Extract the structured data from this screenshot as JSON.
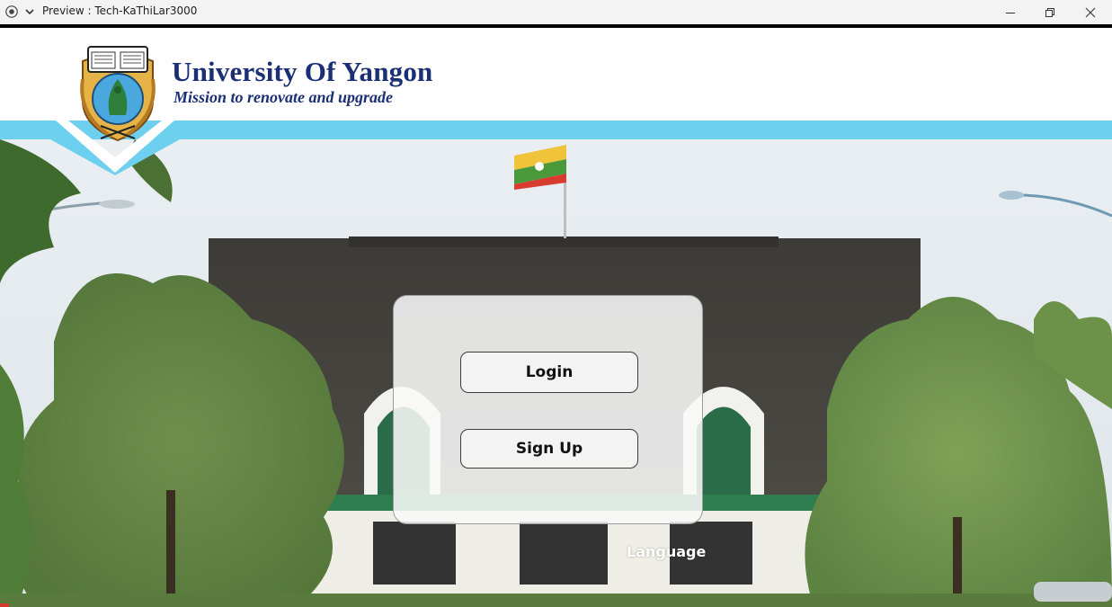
{
  "window": {
    "title": "Preview : Tech-KaThiLar3000",
    "icons": [
      "app-record-icon",
      "chevron-down-icon",
      "minimize-icon",
      "restore-icon",
      "close-icon"
    ]
  },
  "header": {
    "university_name": "University Of Yangon",
    "motto": "Mission to renovate and upgrade",
    "band_color": "#6dd0ef",
    "title_color": "#1b2f75"
  },
  "panel": {
    "login_label": "Login",
    "signup_label": "Sign Up"
  },
  "footer": {
    "language_label": "Language"
  }
}
